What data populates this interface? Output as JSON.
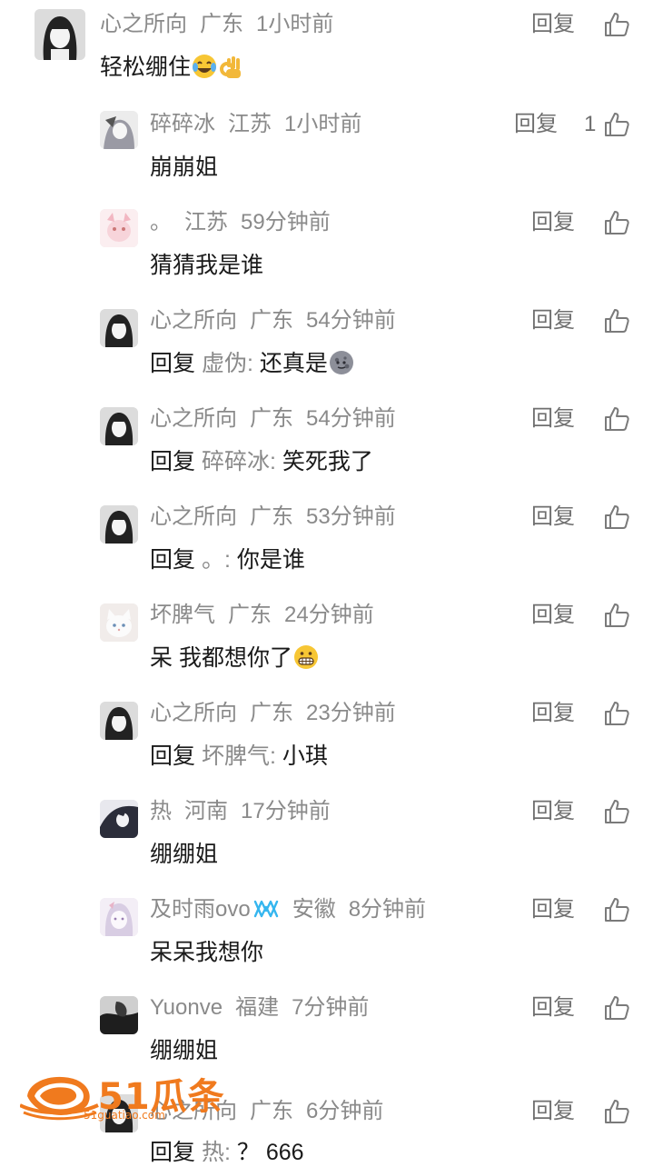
{
  "reply_label": "回复",
  "comments": [
    {
      "user": "心之所向",
      "location": "广东",
      "time": "1小时前",
      "text": "轻松绷住",
      "emoji": [
        "laugh-cry-emoji",
        "ok-hand-emoji"
      ],
      "likes": ""
    },
    {
      "user": "碎碎冰",
      "location": "江苏",
      "time": "1小时前",
      "text": "崩崩姐",
      "likes": "1"
    },
    {
      "user": "。",
      "location": "江苏",
      "time": "59分钟前",
      "text": "猜猜我是谁",
      "likes": ""
    },
    {
      "user": "心之所向",
      "location": "广东",
      "time": "54分钟前",
      "prefix": "回复",
      "mention": "虚伪:",
      "text": "还真是",
      "emoji": [
        "new-moon-face-emoji"
      ],
      "likes": ""
    },
    {
      "user": "心之所向",
      "location": "广东",
      "time": "54分钟前",
      "prefix": "回复",
      "mention": "碎碎冰:",
      "text": "笑死我了",
      "likes": ""
    },
    {
      "user": "心之所向",
      "location": "广东",
      "time": "53分钟前",
      "prefix": "回复",
      "mention": "。:",
      "text": "你是谁",
      "likes": ""
    },
    {
      "user": "坏脾气",
      "location": "广东",
      "time": "24分钟前",
      "text": "呆 我都想你了",
      "emoji": [
        "grimace-emoji"
      ],
      "likes": ""
    },
    {
      "user": "心之所向",
      "location": "广东",
      "time": "23分钟前",
      "prefix": "回复",
      "mention": "坏脾气:",
      "text": "小琪",
      "likes": ""
    },
    {
      "user": "热",
      "location": "河南",
      "time": "17分钟前",
      "text": "绷绷姐",
      "likes": ""
    },
    {
      "user": "及时雨ovo",
      "badge": "infinity-badge-icon",
      "location": "安徽",
      "time": "8分钟前",
      "text": "呆呆我想你",
      "likes": ""
    },
    {
      "user": "Yuonve",
      "location": "福建",
      "time": "7分钟前",
      "text": "绷绷姐",
      "likes": ""
    },
    {
      "user": "心之所向",
      "location": "广东",
      "time": "6分钟前",
      "prefix": "回复",
      "mention": "热:",
      "text": "？ 666",
      "likes": ""
    }
  ],
  "watermark": {
    "brand": "51瓜条",
    "url": "51guatiao.com"
  },
  "colors": {
    "meta": "#8a8a8a",
    "text": "#1a1a1a",
    "watermark": "#f07a1e"
  }
}
